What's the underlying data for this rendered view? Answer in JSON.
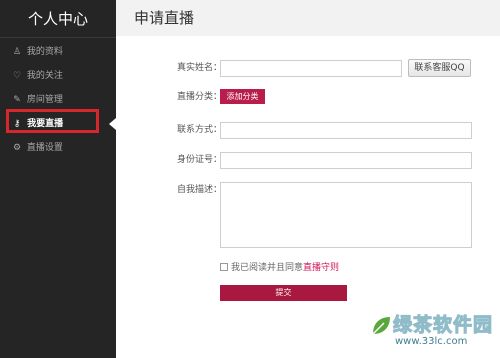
{
  "sidebar": {
    "title": "个人中心",
    "items": [
      {
        "label": "我的资料",
        "icon": "user-icon",
        "glyph": "♙"
      },
      {
        "label": "我的关注",
        "icon": "heart-icon",
        "glyph": "♡"
      },
      {
        "label": "房间管理",
        "icon": "wrench-icon",
        "glyph": "✎"
      },
      {
        "label": "我要直播",
        "icon": "key-icon",
        "glyph": "⚷"
      },
      {
        "label": "直播设置",
        "icon": "gear-icon",
        "glyph": "⚙"
      }
    ],
    "active_index": 3
  },
  "header": {
    "title": "申请直播"
  },
  "form": {
    "real_name": {
      "label": "真实姓名：",
      "value": "",
      "placeholder": ""
    },
    "contact_qq_button": "联系客服QQ",
    "category": {
      "label": "直播分类：",
      "button": "添加分类"
    },
    "contact": {
      "label": "联系方式：",
      "value": "",
      "placeholder": ""
    },
    "id_number": {
      "label": "身份证号：",
      "value": "",
      "placeholder": ""
    },
    "description": {
      "label": "自我描述：",
      "value": "",
      "placeholder": ""
    },
    "agree": {
      "text": "我已阅读并且同意",
      "link": "直播守则",
      "checked": false
    },
    "submit_label": "提交"
  },
  "watermark": {
    "text": "绿茶软件园",
    "url": "www.33lc.com"
  },
  "colors": {
    "sidebar_bg": "#252525",
    "accent": "#b91d4c",
    "highlight": "#d6282c",
    "link": "#d1155a"
  }
}
